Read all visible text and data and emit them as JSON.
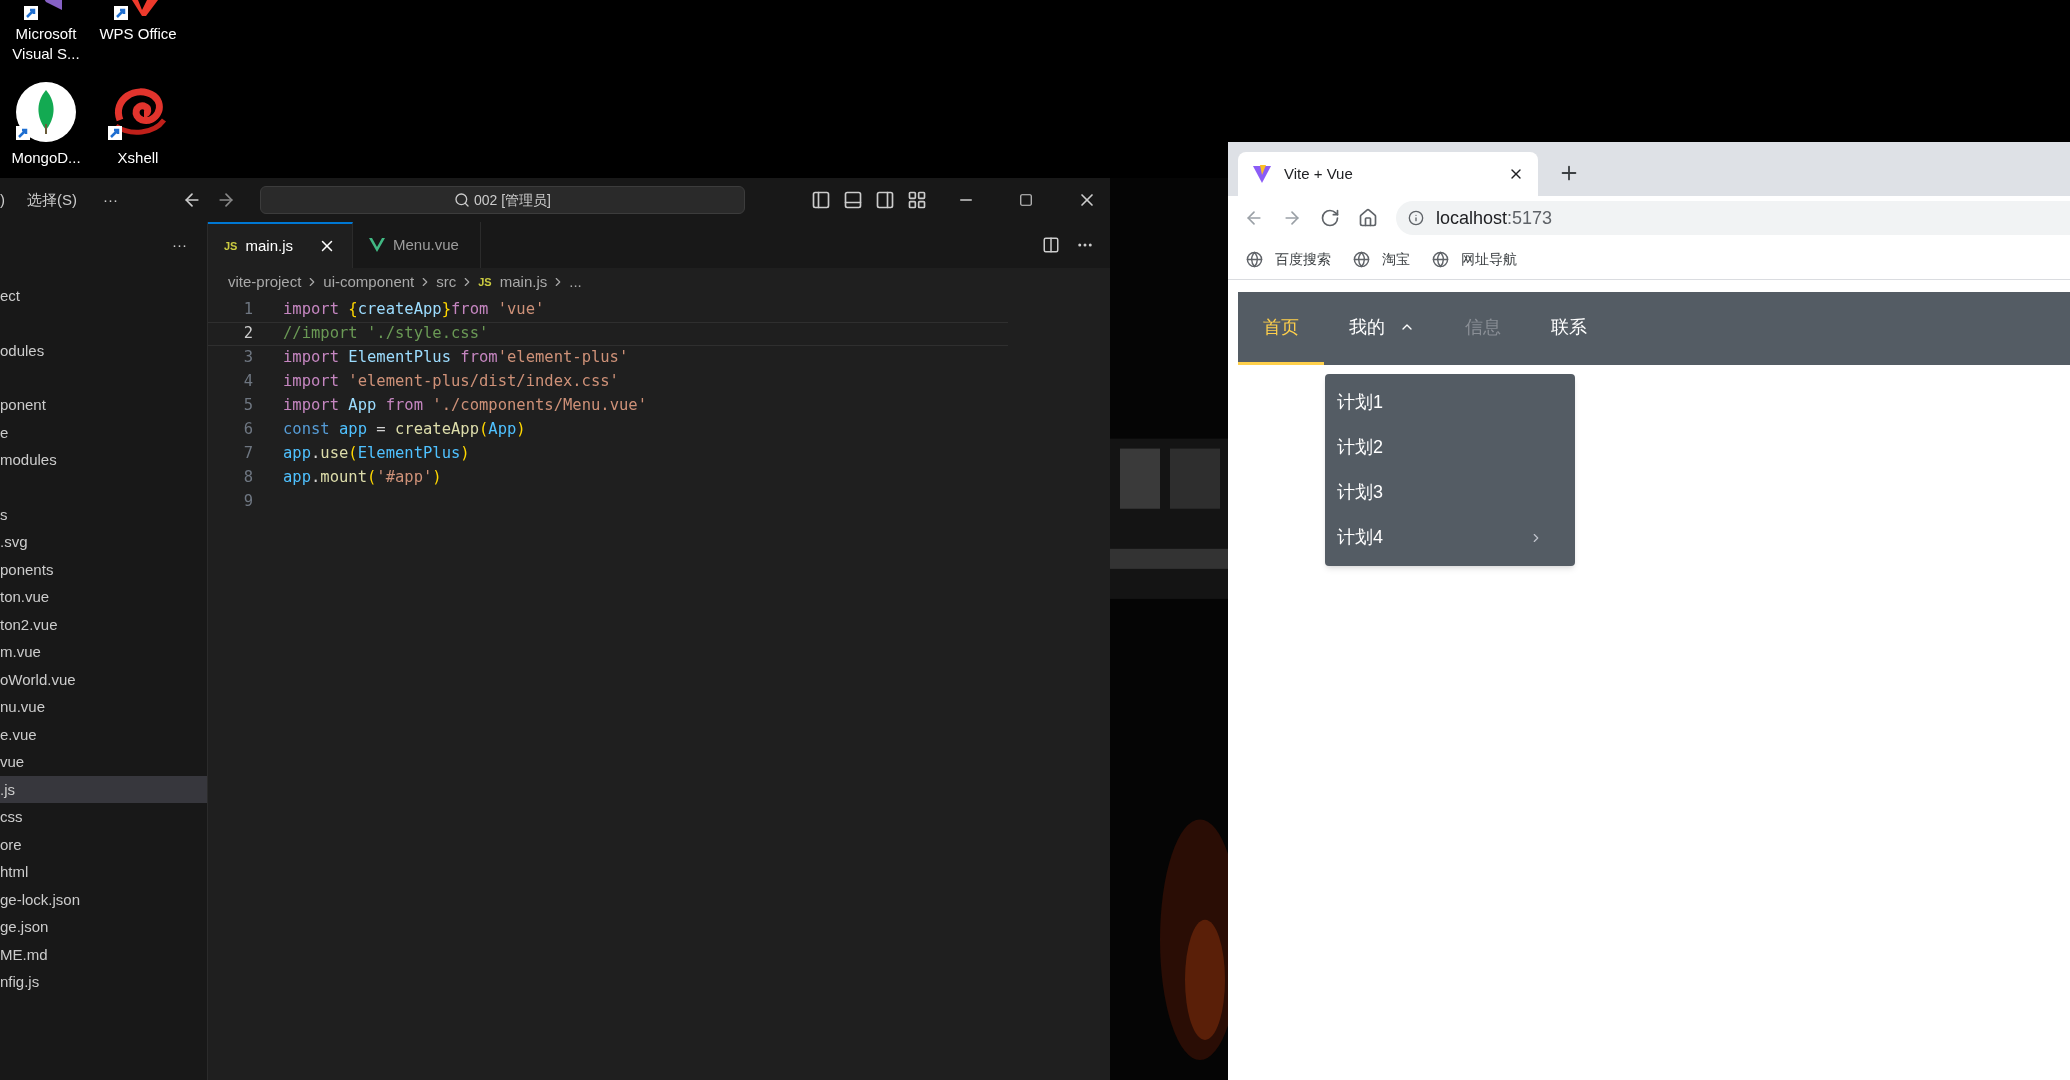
{
  "desktop_icons": [
    {
      "label": "Microsoft Visual S...",
      "kind": "vs"
    },
    {
      "label": "WPS Office",
      "kind": "wps"
    },
    {
      "label": "MongoD...",
      "kind": "mongo"
    },
    {
      "label": "Xshell",
      "kind": "xshell"
    }
  ],
  "editor": {
    "menu_fragment": ")",
    "menu": "选择(S)",
    "more": "···",
    "search": "002 [管理员]",
    "explorer_more": "···",
    "sidebar": [
      {
        "label": "ect",
        "selected": false
      },
      {
        "label": "odules",
        "selected": false
      },
      {
        "label": "ponent",
        "selected": false
      },
      {
        "label": "e",
        "selected": false
      },
      {
        "label": "modules",
        "selected": false
      },
      {
        "label": "s",
        "selected": false
      },
      {
        "label": ".svg",
        "selected": false
      },
      {
        "label": "ponents",
        "selected": false
      },
      {
        "label": "ton.vue",
        "selected": false
      },
      {
        "label": "ton2.vue",
        "selected": false
      },
      {
        "label": "m.vue",
        "selected": false
      },
      {
        "label": "oWorld.vue",
        "selected": false
      },
      {
        "label": "nu.vue",
        "selected": false
      },
      {
        "label": "e.vue",
        "selected": false
      },
      {
        "label": "vue",
        "selected": false
      },
      {
        "label": ".js",
        "selected": true
      },
      {
        "label": "css",
        "selected": false
      },
      {
        "label": "ore",
        "selected": false
      },
      {
        "label": "html",
        "selected": false
      },
      {
        "label": "ge-lock.json",
        "selected": false
      },
      {
        "label": "ge.json",
        "selected": false
      },
      {
        "label": "ME.md",
        "selected": false
      },
      {
        "label": "nfig.js",
        "selected": false
      }
    ],
    "tabs": [
      {
        "label": "main.js",
        "kind": "js",
        "badge": "JS",
        "selected": true
      },
      {
        "label": "Menu.vue",
        "kind": "vue",
        "selected": false
      }
    ],
    "breadcrumb": [
      {
        "label": "vite-project"
      },
      {
        "label": "ui-component"
      },
      {
        "label": "src"
      },
      {
        "label": "main.js",
        "badge": "JS"
      },
      {
        "label": "..."
      }
    ],
    "lines": [
      {
        "number": "1",
        "current": false,
        "tokens": [
          {
            "t": "import ",
            "kind": "keyword"
          },
          {
            "t": "{",
            "kind": "brace"
          },
          {
            "t": "createApp",
            "kind": "variable"
          },
          {
            "t": "}",
            "kind": "brace"
          },
          {
            "t": "from ",
            "kind": "keyword"
          },
          {
            "t": "'vue'",
            "kind": "string"
          }
        ]
      },
      {
        "number": "2",
        "current": true,
        "tokens": [
          {
            "t": "//import './style.css'",
            "kind": "comment"
          }
        ]
      },
      {
        "number": "3",
        "current": false,
        "tokens": [
          {
            "t": "import ",
            "kind": "keyword"
          },
          {
            "t": "ElementPlus ",
            "kind": "variable"
          },
          {
            "t": "from",
            "kind": "keyword"
          },
          {
            "t": "'element-plus'",
            "kind": "string"
          }
        ]
      },
      {
        "number": "4",
        "current": false,
        "tokens": [
          {
            "t": "import ",
            "kind": "keyword"
          },
          {
            "t": "'element-plus/dist/index.css'",
            "kind": "string"
          }
        ]
      },
      {
        "number": "5",
        "current": false,
        "tokens": [
          {
            "t": "import ",
            "kind": "keyword"
          },
          {
            "t": "App ",
            "kind": "variable"
          },
          {
            "t": "from ",
            "kind": "keyword"
          },
          {
            "t": "'./components/Menu.vue'",
            "kind": "string"
          }
        ]
      },
      {
        "number": "6",
        "current": false,
        "tokens": [
          {
            "t": "const ",
            "kind": "storage"
          },
          {
            "t": "app",
            "kind": "constant"
          },
          {
            "t": " = ",
            "kind": "plain"
          },
          {
            "t": "createApp",
            "kind": "function"
          },
          {
            "t": "(",
            "kind": "brace"
          },
          {
            "t": "App",
            "kind": "constant"
          },
          {
            "t": ")",
            "kind": "brace"
          }
        ]
      },
      {
        "number": "7",
        "current": false,
        "tokens": [
          {
            "t": "app",
            "kind": "constant"
          },
          {
            "t": ".",
            "kind": "plain"
          },
          {
            "t": "use",
            "kind": "function"
          },
          {
            "t": "(",
            "kind": "brace"
          },
          {
            "t": "ElementPlus",
            "kind": "constant"
          },
          {
            "t": ")",
            "kind": "brace"
          }
        ]
      },
      {
        "number": "8",
        "current": false,
        "tokens": [
          {
            "t": "app",
            "kind": "constant"
          },
          {
            "t": ".",
            "kind": "plain"
          },
          {
            "t": "mount",
            "kind": "function"
          },
          {
            "t": "(",
            "kind": "brace"
          },
          {
            "t": "'#app'",
            "kind": "string"
          },
          {
            "t": ")",
            "kind": "brace"
          }
        ]
      },
      {
        "number": "9",
        "current": false
      }
    ]
  },
  "browser": {
    "tab": {
      "title": "Vite + Vue"
    },
    "url_host": "localhost",
    "url_port": ":5173",
    "bookmarks": [
      {
        "label": "百度搜索"
      },
      {
        "label": "淘宝"
      },
      {
        "label": "网址导航"
      }
    ],
    "nav": [
      {
        "label": "首页",
        "selected": true,
        "disabled": false
      },
      {
        "label": "我的",
        "selected": false,
        "disabled": false,
        "expanded": true
      },
      {
        "label": "信息",
        "selected": false,
        "disabled": true
      },
      {
        "label": "联系",
        "selected": false,
        "disabled": false
      }
    ],
    "dropdown": [
      {
        "label": "计划1",
        "has_submenu": false
      },
      {
        "label": "计划2",
        "has_submenu": false
      },
      {
        "label": "计划3",
        "has_submenu": false
      },
      {
        "label": "计划4",
        "has_submenu": true
      }
    ]
  }
}
